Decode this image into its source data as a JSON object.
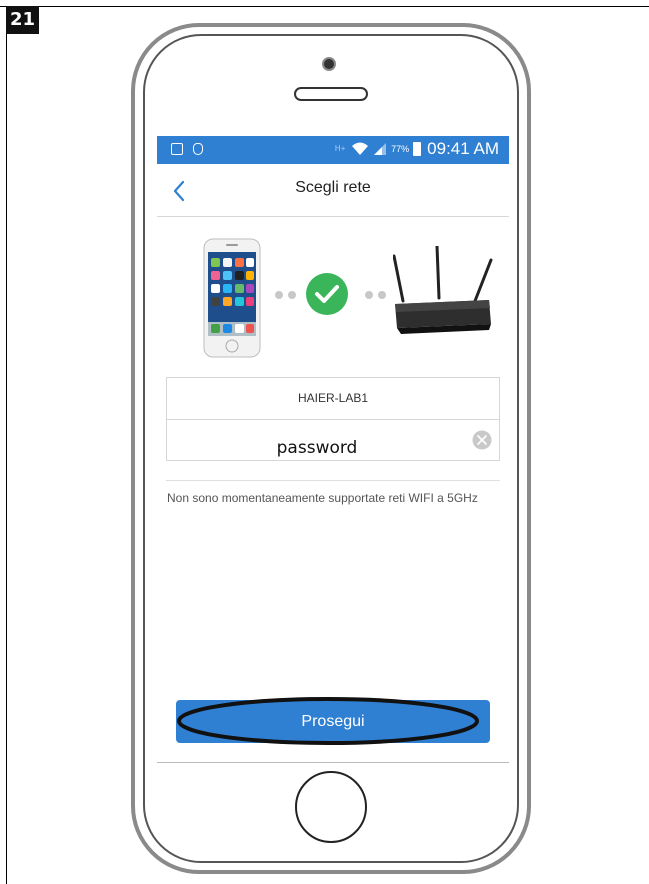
{
  "step": {
    "number": "21"
  },
  "status_bar": {
    "network_type": "H+",
    "battery_percent": "77%",
    "time": "09:41 AM",
    "color": "#2f7fd2"
  },
  "nav": {
    "title": "Scegli rete",
    "back_icon": "chevron-left-icon"
  },
  "illustration": {
    "left_device": "smartphone-image",
    "status_icon": "checkmark-circle-icon",
    "status_color": "#3bb55a",
    "right_device": "router-image"
  },
  "form": {
    "network_name": "HAIER-LAB1",
    "password_value": "password",
    "clear_icon": "clear-circle-icon"
  },
  "note": "Non sono momentaneamente supportate reti WIFI a 5GHz",
  "continue_button": {
    "label": "Prosegui",
    "color": "#2f7fd2"
  },
  "annotation": {
    "highlight": "ellipse-around-button"
  }
}
